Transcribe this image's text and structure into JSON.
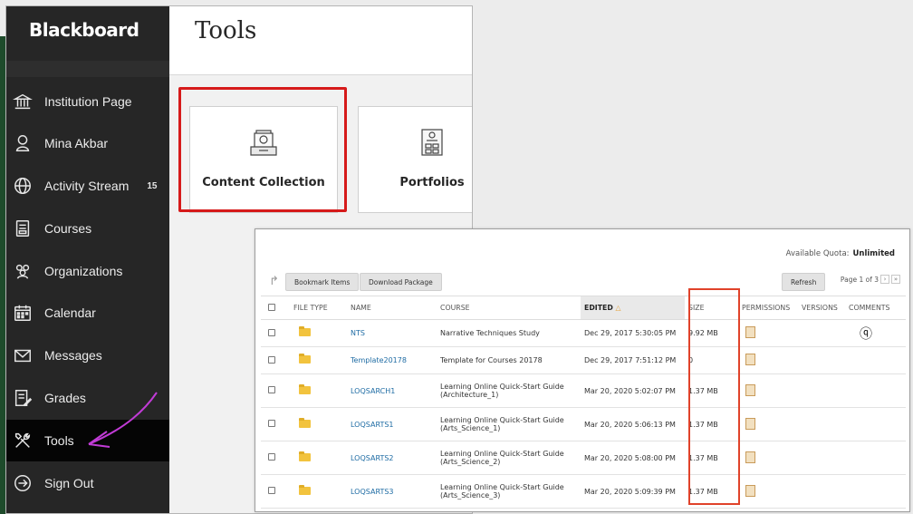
{
  "brand": "Blackboard",
  "sidebar": {
    "items": [
      {
        "label": "Institution Page",
        "icon": "institution-icon"
      },
      {
        "label": "Mina Akbar",
        "icon": "person-icon"
      },
      {
        "label": "Activity Stream",
        "icon": "globe-icon",
        "badge": "15"
      },
      {
        "label": "Courses",
        "icon": "courses-icon"
      },
      {
        "label": "Organizations",
        "icon": "organizations-icon"
      },
      {
        "label": "Calendar",
        "icon": "calendar-icon"
      },
      {
        "label": "Messages",
        "icon": "envelope-icon"
      },
      {
        "label": "Grades",
        "icon": "grades-icon"
      },
      {
        "label": "Tools",
        "icon": "tools-icon",
        "active": true
      },
      {
        "label": "Sign Out",
        "icon": "sign-out-icon"
      }
    ]
  },
  "page": {
    "title": "Tools",
    "cards": [
      {
        "label": "Content Collection",
        "icon": "content-collection-icon"
      },
      {
        "label": "Portfolios",
        "icon": "portfolios-icon"
      }
    ]
  },
  "files_panel": {
    "quota_label": "Available Quota:",
    "quota_value": "Unlimited",
    "bookmark_button": "Bookmark Items",
    "download_button": "Download Package",
    "refresh_button": "Refresh",
    "pager_text": "Page 1 of 3",
    "columns": {
      "file_type": "FILE TYPE",
      "name": "NAME",
      "course": "COURSE",
      "edited": "EDITED",
      "size": "SIZE",
      "permissions": "PERMISSIONS",
      "versions": "VERSIONS",
      "comments": "COMMENTS"
    },
    "rows": [
      {
        "name": "NTS",
        "course_line1": "Narrative Techniques Study",
        "course_line2": "",
        "edited": "Dec 29, 2017 5:30:05 PM",
        "size": "9.92 MB",
        "has_comment": true
      },
      {
        "name": "Template20178",
        "course_line1": "Template for Courses 20178",
        "course_line2": "",
        "edited": "Dec 29, 2017 7:51:12 PM",
        "size": "0",
        "has_comment": false
      },
      {
        "name": "LOQSARCH1",
        "course_line1": "Learning Online Quick-Start Guide",
        "course_line2": "(Architecture_1)",
        "edited": "Mar 20, 2020 5:02:07 PM",
        "size": "1.37 MB",
        "has_comment": false
      },
      {
        "name": "LOQSARTS1",
        "course_line1": "Learning Online Quick-Start Guide",
        "course_line2": "(Arts_Science_1)",
        "edited": "Mar 20, 2020 5:06:13 PM",
        "size": "1.37 MB",
        "has_comment": false
      },
      {
        "name": "LOQSARTS2",
        "course_line1": "Learning Online Quick-Start Guide",
        "course_line2": "(Arts_Science_2)",
        "edited": "Mar 20, 2020 5:08:00 PM",
        "size": "1.37 MB",
        "has_comment": false
      },
      {
        "name": "LOQSARTS3",
        "course_line1": "Learning Online Quick-Start Guide",
        "course_line2": "(Arts_Science_3)",
        "edited": "Mar 20, 2020 5:09:39 PM",
        "size": "1.37 MB",
        "has_comment": false
      }
    ]
  },
  "colors": {
    "sidebar_bg": "#262626",
    "active_bg": "#050505",
    "highlight_red": "#d61a1a",
    "annotation_purple": "#c13bd6",
    "link_blue": "#1f6ca4",
    "folder_yellow": "#f2c33e"
  }
}
